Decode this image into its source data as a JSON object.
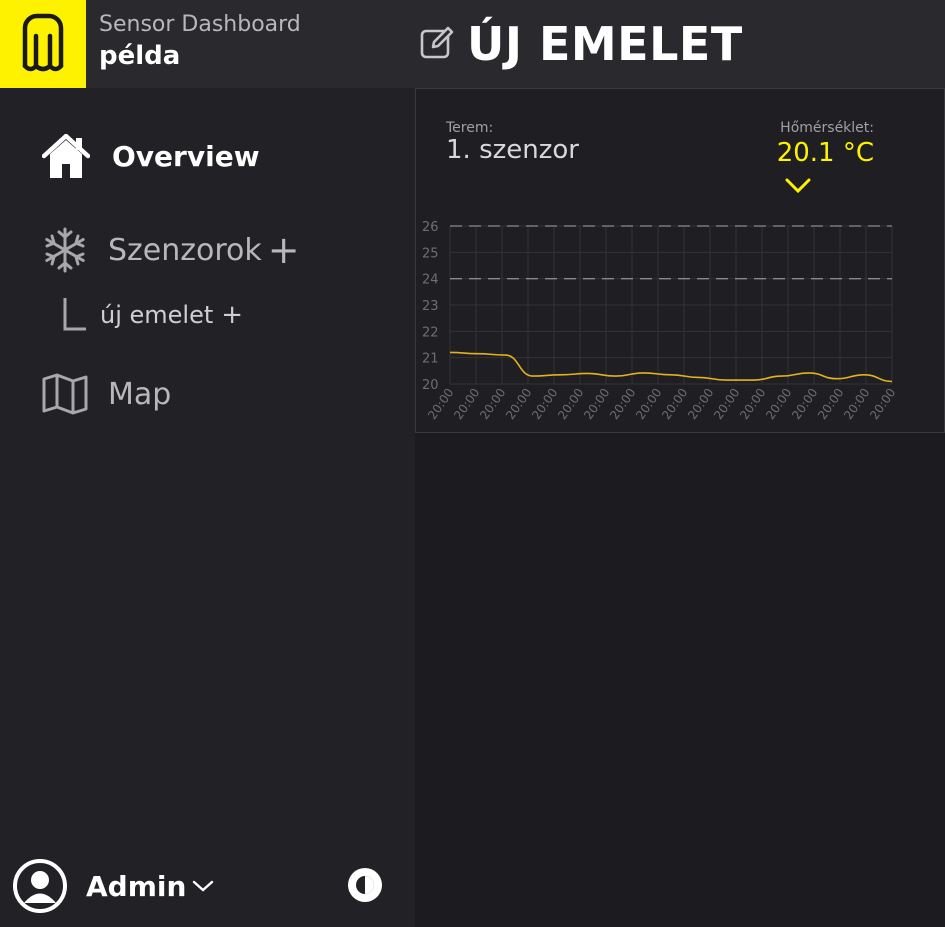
{
  "header": {
    "app_name": "Sensor Dashboard",
    "org_name": "példa",
    "page_title": "ÚJ EMELET",
    "logo_icon": "m-logo-icon",
    "edit_icon": "edit-icon"
  },
  "colors": {
    "accent": "#fff200",
    "background": "#1c1c20",
    "sidebar": "#222226",
    "header": "#2a2a2e",
    "line": "#e3b21d"
  },
  "sidebar": {
    "items": [
      {
        "label": "Overview",
        "icon": "home-icon"
      },
      {
        "label": "Szenzorok",
        "icon": "snowflake-icon",
        "action": "+"
      },
      {
        "label": "új emelet",
        "icon": "subitem-connector-icon",
        "action": "+"
      },
      {
        "label": "Map",
        "icon": "map-icon"
      }
    ],
    "user": {
      "label": "Admin",
      "icon": "user-avatar-icon"
    },
    "theme_icon": "contrast-icon"
  },
  "card": {
    "room_label": "Terem:",
    "room_name": "1. szenzor",
    "temp_label": "Hőmérséklet:",
    "temp_value": "20.1 °C"
  },
  "chart_data": {
    "type": "line",
    "y_ticks": [
      "20",
      "21",
      "22",
      "23",
      "24",
      "25",
      "26"
    ],
    "ylim": [
      20,
      26
    ],
    "x": [
      "20:00",
      "20:00",
      "20:00",
      "20:00",
      "20:00",
      "20:00",
      "20:00",
      "20:00",
      "20:00",
      "20:00",
      "20:00",
      "20:00",
      "20:00",
      "20:00",
      "20:00",
      "20:00",
      "20:00",
      "20:00"
    ],
    "values": [
      21.2,
      21.15,
      21.1,
      20.3,
      20.35,
      20.4,
      20.3,
      20.42,
      20.35,
      20.25,
      20.15,
      20.15,
      20.3,
      20.42,
      20.2,
      20.35,
      20.1
    ],
    "thresholds": [
      24,
      26
    ],
    "grid": true
  }
}
